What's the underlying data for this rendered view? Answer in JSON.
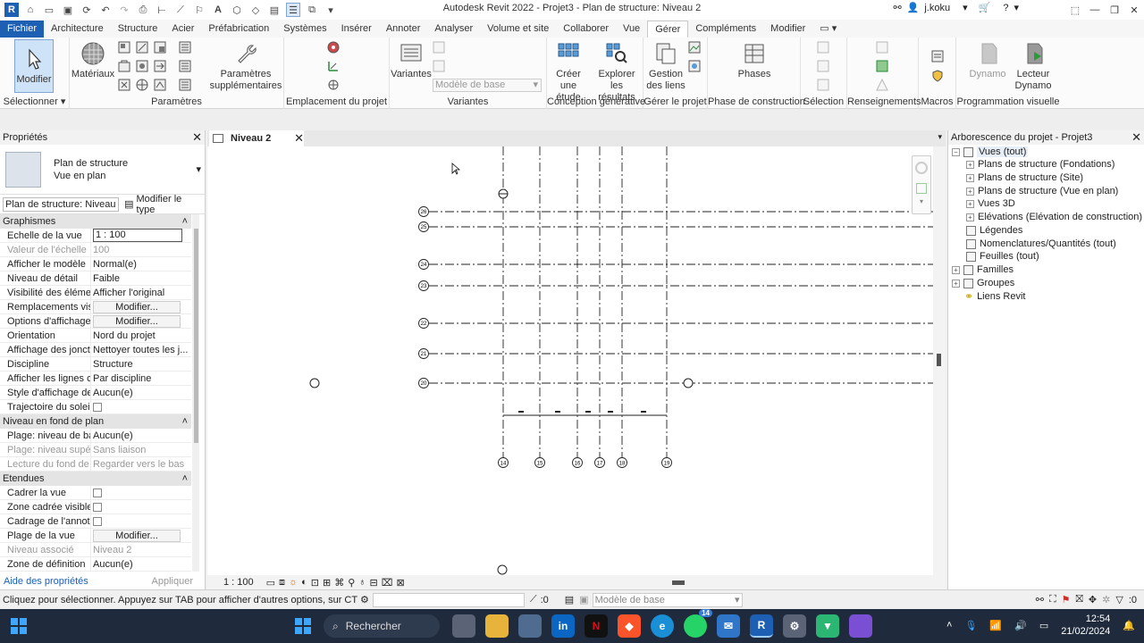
{
  "title_bar": {
    "title": "Autodesk Revit 2022 - Projet3 - Plan de structure: Niveau 2",
    "user": "j.koku"
  },
  "ribbon_tabs": [
    "Fichier",
    "Architecture",
    "Structure",
    "Acier",
    "Préfabrication",
    "Systèmes",
    "Insérer",
    "Annoter",
    "Analyser",
    "Volume et site",
    "Collaborer",
    "Vue",
    "Gérer",
    "Compléments",
    "Modifier"
  ],
  "active_tab": "Gérer",
  "ribbon": {
    "modifier": "Modifier",
    "selectionner": "Sélectionner",
    "materiaux": "Matériaux",
    "parametres_supp": "Paramètres supplémentaires",
    "parametres": "Paramètres",
    "emplacement": "Emplacement du projet",
    "variantes_btn": "Variantes",
    "modele_de_base": "Modèle de base",
    "variantes": "Variantes",
    "creer_etude": "Créer une étude",
    "explorer": "Explorer les résultats",
    "conception": "Conception générative",
    "gestion_liens": "Gestion des liens",
    "gerer_projet": "Gérer le projet",
    "phases": "Phases",
    "phase_construction": "Phase de construction",
    "selection": "Sélection",
    "renseignements": "Renseignements",
    "macros": "Macros",
    "dynamo": "Dynamo",
    "lecteur_dynamo": "Lecteur Dynamo",
    "programmation": "Programmation visuelle"
  },
  "properties": {
    "header": "Propriétés",
    "type_line1": "Plan de structure",
    "type_line2": "Vue en plan",
    "instance_selector": "Plan de structure: Niveau",
    "edit_type": "Modifier le type",
    "sections": {
      "graphismes": "Graphismes",
      "niveau_fond": "Niveau en fond de plan",
      "etendues": "Etendues"
    },
    "rows": {
      "echelle": [
        "Echelle de la vue",
        "1 : 100"
      ],
      "valeur_echelle": [
        "Valeur de l'échelle",
        "100"
      ],
      "afficher_modele": [
        "Afficher le modèle",
        "Normal(e)"
      ],
      "niveau_detail": [
        "Niveau de détail",
        "Faible"
      ],
      "visibilite": [
        "Visibilité des éléme...",
        "Afficher l'original"
      ],
      "remplacements": [
        "Remplacements visi...",
        "Modifier..."
      ],
      "options_affichage": [
        "Options d'affichage...",
        "Modifier..."
      ],
      "orientation": [
        "Orientation",
        "Nord du projet"
      ],
      "affichage_jonct": [
        "Affichage des jonct...",
        "Nettoyer toutes les j..."
      ],
      "discipline": [
        "Discipline",
        "Structure"
      ],
      "afficher_lignes": [
        "Afficher les lignes c...",
        "Par discipline"
      ],
      "style_affichage": [
        "Style d'affichage de...",
        "Aucun(e)"
      ],
      "trajectoire": [
        "Trajectoire du soleil",
        ""
      ],
      "plage_base": [
        "Plage: niveau de ba...",
        "Aucun(e)"
      ],
      "plage_sup": [
        "Plage: niveau supéri...",
        "Sans liaison"
      ],
      "lecture_fond": [
        "Lecture du fond de ...",
        "Regarder vers le bas"
      ],
      "cadrer": [
        "Cadrer la vue",
        ""
      ],
      "zone_cadree": [
        "Zone cadrée visible",
        ""
      ],
      "cadrage_annot": [
        "Cadrage de l'annot...",
        ""
      ],
      "plage_vue": [
        "Plage de la vue",
        "Modifier..."
      ],
      "niveau_associe": [
        "Niveau associé",
        "Niveau 2"
      ],
      "zone_definition": [
        "Zone de définition",
        "Aucun(e)"
      ]
    },
    "help_link": "Aide des propriétés",
    "apply": "Appliquer"
  },
  "view_tab": "Niveau 2",
  "view_scale": "1 : 100",
  "grids": {
    "vertical": [
      "14",
      "15",
      "16",
      "17",
      "18",
      "19"
    ],
    "horizontal": [
      "26",
      "25",
      "24",
      "23",
      "22",
      "21",
      "20"
    ]
  },
  "browser": {
    "header": "Arborescence du projet - Projet3",
    "items": [
      "Vues (tout)",
      "Plans de structure (Fondations)",
      "Plans de structure (Site)",
      "Plans de structure (Vue en plan)",
      "Vues 3D",
      "Elévations (Elévation de construction)",
      "Légendes",
      "Nomenclatures/Quantités (tout)",
      "Feuilles (tout)",
      "Familles",
      "Groupes",
      "Liens Revit"
    ]
  },
  "status": {
    "message": "Cliquez pour sélectionner. Appuyez sur TAB pour afficher d'autres options, sur CTRL pour a",
    "selection_count": ":0",
    "model": "Modèle de base",
    "filter_count": ":0"
  },
  "taskbar": {
    "search": "Rechercher",
    "time": "12:54",
    "date": "21/02/2024",
    "whatsapp_badge": "14"
  }
}
